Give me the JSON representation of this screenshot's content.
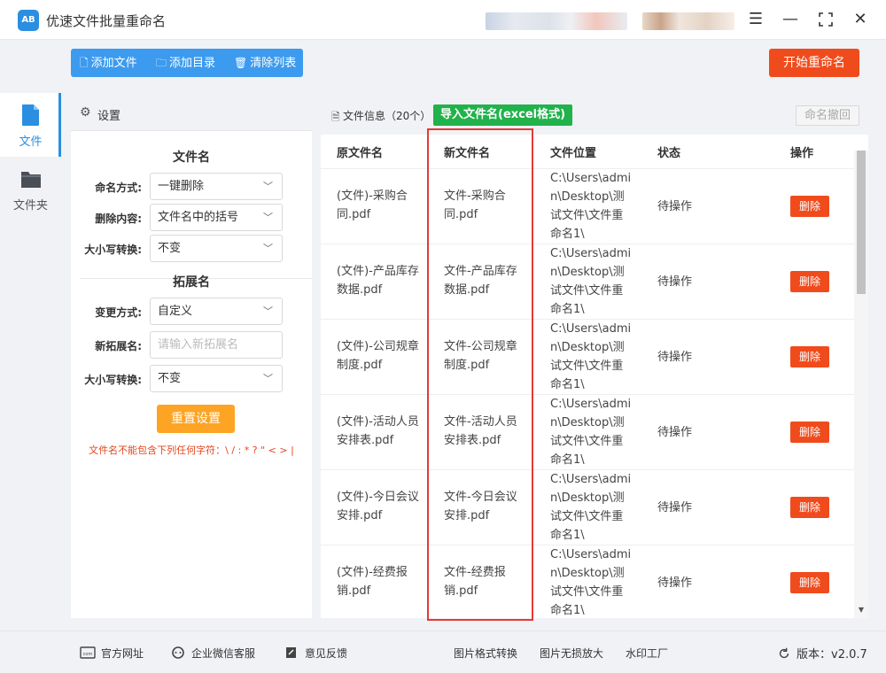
{
  "app": {
    "title": "优速文件批量重命名",
    "logo_text": "AB"
  },
  "nav": {
    "files_label": "文件",
    "folder_label": "文件夹"
  },
  "toolbar": {
    "add_file": "添加文件",
    "add_dir": "添加目录",
    "clear_list": "清除列表",
    "start": "开始重命名"
  },
  "settings": {
    "header": "设置",
    "filename_section": "文件名",
    "naming_mode_label": "命名方式:",
    "naming_mode_value": "一键删除",
    "delete_content_label": "删除内容:",
    "delete_content_value": "文件名中的括号",
    "case_label": "大小写转换:",
    "case_value": "不变",
    "ext_section": "拓展名",
    "change_mode_label": "变更方式:",
    "change_mode_value": "自定义",
    "new_ext_label": "新拓展名:",
    "new_ext_placeholder": "请输入新拓展名",
    "ext_case_label": "大小写转换:",
    "ext_case_value": "不变",
    "reset": "重置设置",
    "warning": "文件名不能包含下列任何字符：\\ / : * ? \" < > |"
  },
  "filelist": {
    "info": "文件信息（20个）",
    "import_btn": "导入文件名(excel格式)",
    "undo_btn": "命名撤回",
    "headers": {
      "original": "原文件名",
      "new": "新文件名",
      "location": "文件位置",
      "status": "状态",
      "action": "操作"
    },
    "rows": [
      {
        "original": "(文件)-采购合同.pdf",
        "new": "文件-采购合同.pdf",
        "location": "C:\\Users\\admin\\Desktop\\测试文件\\文件重命名1\\",
        "status": "待操作",
        "action": "删除"
      },
      {
        "original": "(文件)-产品库存数据.pdf",
        "new": "文件-产品库存数据.pdf",
        "location": "C:\\Users\\admin\\Desktop\\测试文件\\文件重命名1\\",
        "status": "待操作",
        "action": "删除"
      },
      {
        "original": "(文件)-公司规章制度.pdf",
        "new": "文件-公司规章制度.pdf",
        "location": "C:\\Users\\admin\\Desktop\\测试文件\\文件重命名1\\",
        "status": "待操作",
        "action": "删除"
      },
      {
        "original": "(文件)-活动人员安排表.pdf",
        "new": "文件-活动人员安排表.pdf",
        "location": "C:\\Users\\admin\\Desktop\\测试文件\\文件重命名1\\",
        "status": "待操作",
        "action": "删除"
      },
      {
        "original": "(文件)-今日会议安排.pdf",
        "new": "文件-今日会议安排.pdf",
        "location": "C:\\Users\\admin\\Desktop\\测试文件\\文件重命名1\\",
        "status": "待操作",
        "action": "删除"
      },
      {
        "original": "(文件)-经费报销.pdf",
        "new": "文件-经费报销.pdf",
        "location": "C:\\Users\\admin\\Desktop\\测试文件\\文件重命名1\\",
        "status": "待操作",
        "action": "删除"
      }
    ]
  },
  "footer": {
    "website": "官方网址",
    "wechat": "企业微信客服",
    "feedback": "意见反馈",
    "image_convert": "图片格式转换",
    "image_zoom": "图片无损放大",
    "watermark": "水印工厂",
    "version": "版本：v2.0.7"
  },
  "colors": {
    "primary": "#2a8fe0",
    "toolbar": "#3d9bef",
    "danger": "#f04b1c",
    "warning_btn": "#fda424",
    "import_green": "#21b24b",
    "highlight_red": "#e53935"
  }
}
